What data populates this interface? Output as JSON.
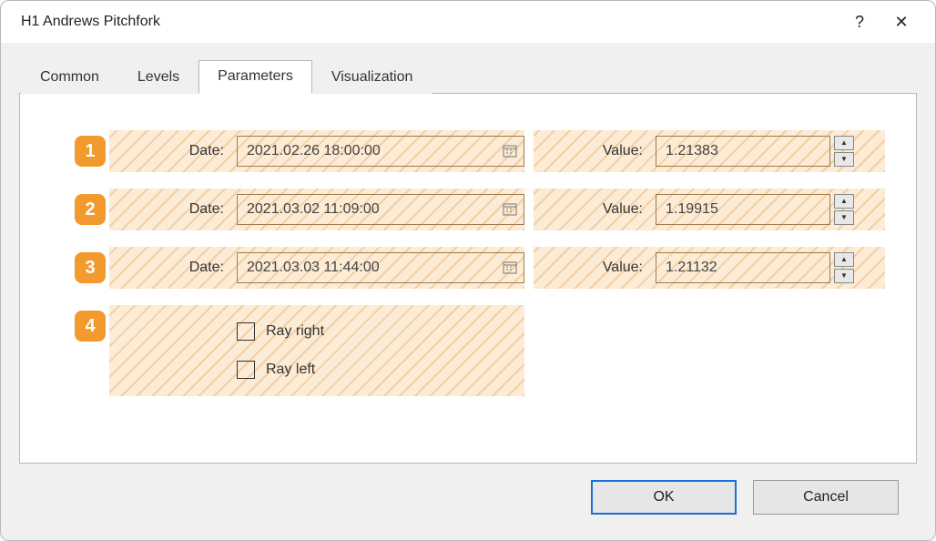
{
  "window": {
    "title": "H1 Andrews Pitchfork",
    "help": "?",
    "close": "✕"
  },
  "tabs": {
    "t0": "Common",
    "t1": "Levels",
    "t2": "Parameters",
    "t3": "Visualization",
    "active_index": 2
  },
  "params": {
    "date_label": "Date:",
    "value_label": "Value:",
    "rows": {
      "r1": {
        "num": "1",
        "date": "2021.02.26 18:00:00",
        "value": "1.21383"
      },
      "r2": {
        "num": "2",
        "date": "2021.03.02 11:09:00",
        "value": "1.19915"
      },
      "r3": {
        "num": "3",
        "date": "2021.03.03 11:44:00",
        "value": "1.21132"
      }
    },
    "row4_num": "4",
    "ray_right": "Ray right",
    "ray_left": "Ray left"
  },
  "footer": {
    "ok": "OK",
    "cancel": "Cancel"
  }
}
